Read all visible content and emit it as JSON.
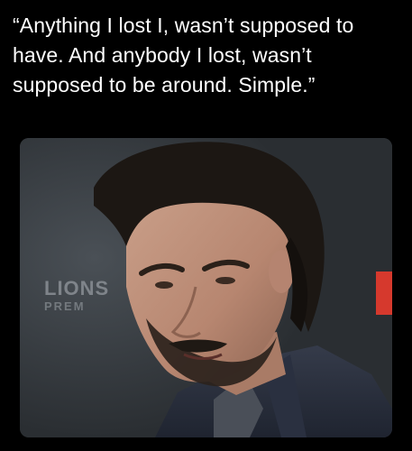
{
  "quote": {
    "text": "“Anything I lost I, wasn’t supposed to have. And anybody I lost, wasn’t supposed to be around. Simple.”"
  },
  "photo": {
    "backdrop_logo_line1": "LIONS",
    "backdrop_logo_line2": "PREM",
    "accent_color": "#d6392d"
  }
}
